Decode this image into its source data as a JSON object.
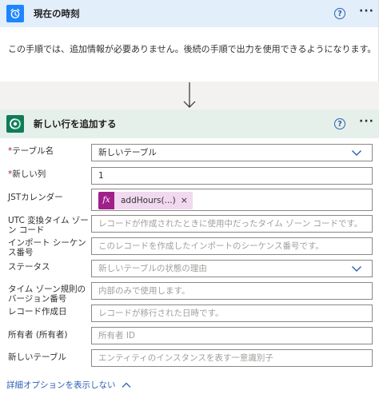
{
  "step1": {
    "title": "現在の時刻",
    "help": "?",
    "more": "···",
    "message": "この手順では、追加情報が必要ありません。後続の手順で出力を使用できるようになります。"
  },
  "step2": {
    "title": "新しい行を追加する",
    "help": "?",
    "more": "···",
    "fields": [
      {
        "label": "テーブル名",
        "required": "*",
        "value": "新しいテーブル"
      },
      {
        "label": "新しい列",
        "required": "*",
        "value": "1"
      },
      {
        "label": "JSTカレンダー",
        "token": "addHours(...)",
        "token_icon": "fx",
        "remove": "×"
      },
      {
        "label": "UTC 変換タイム ゾーン コード",
        "placeholder": "レコードが作成されたときに使用中だったタイム ゾーン コードです。"
      },
      {
        "label": "インポート シーケンス番号",
        "placeholder": "このレコードを作成したインポートのシーケンス番号です。"
      },
      {
        "label": "ステータス",
        "placeholder": "新しいテーブルの状態の理由"
      },
      {
        "label": "タイム ゾーン規則のバージョン番号",
        "placeholder": "内部のみで使用します。"
      },
      {
        "label": "レコード作成日",
        "placeholder": "レコードが移行された日時です。"
      },
      {
        "label": "所有者 (所有者)",
        "placeholder": "所有者 ID"
      },
      {
        "label": "新しいテーブル",
        "placeholder": "エンティティのインスタンスを表す一意識別子"
      }
    ],
    "advanced_link": "詳細オプションを表示しない"
  },
  "colors": {
    "step1_header": "#e3eefb",
    "step2_header": "#e6f0ea",
    "trigger_icon": "#1f85ff",
    "dataverse_icon": "#107c59",
    "expression_token": "#a0208b",
    "link": "#2b5fb4"
  }
}
